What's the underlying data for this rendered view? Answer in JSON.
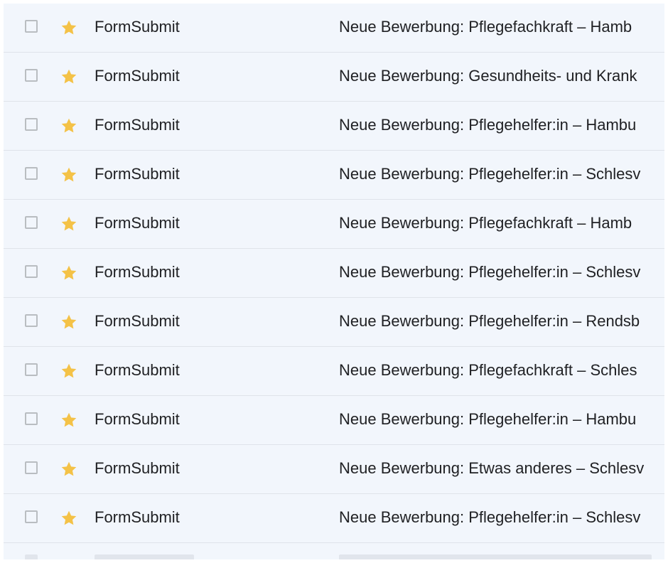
{
  "colors": {
    "row_background": "#f2f6fc",
    "row_divider": "#dfe3ea",
    "star": "#f4c247",
    "checkbox_border": "#b9bdc1",
    "text": "#202124"
  },
  "icons": {
    "star": "star-icon",
    "checkbox": "checkbox-icon"
  },
  "emails": [
    {
      "sender": "FormSubmit",
      "subject": "Neue Bewerbung: Pflegefachkraft – Hamb",
      "starred": true
    },
    {
      "sender": "FormSubmit",
      "subject": "Neue Bewerbung: Gesundheits- und Krank",
      "starred": true
    },
    {
      "sender": "FormSubmit",
      "subject": "Neue Bewerbung: Pflegehelfer:in – Hambu",
      "starred": true
    },
    {
      "sender": "FormSubmit",
      "subject": "Neue Bewerbung: Pflegehelfer:in – Schlesv",
      "starred": true
    },
    {
      "sender": "FormSubmit",
      "subject": "Neue Bewerbung: Pflegefachkraft – Hamb",
      "starred": true
    },
    {
      "sender": "FormSubmit",
      "subject": "Neue Bewerbung: Pflegehelfer:in – Schlesv",
      "starred": true
    },
    {
      "sender": "FormSubmit",
      "subject": "Neue Bewerbung: Pflegehelfer:in – Rendsb",
      "starred": true
    },
    {
      "sender": "FormSubmit",
      "subject": "Neue Bewerbung: Pflegefachkraft – Schles",
      "starred": true
    },
    {
      "sender": "FormSubmit",
      "subject": "Neue Bewerbung: Pflegehelfer:in – Hambu",
      "starred": true
    },
    {
      "sender": "FormSubmit",
      "subject": "Neue Bewerbung: Etwas anderes – Schlesv",
      "starred": true
    },
    {
      "sender": "FormSubmit",
      "subject": "Neue Bewerbung: Pflegehelfer:in – Schlesv",
      "starred": true
    }
  ]
}
